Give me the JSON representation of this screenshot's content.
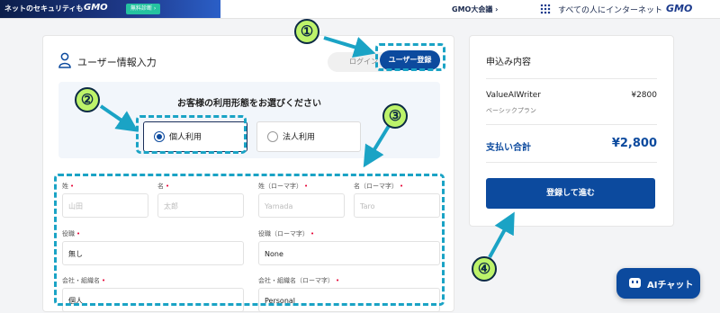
{
  "topbar": {
    "promo_text": "ネットのセキュリティも",
    "promo_logo": "GMO",
    "promo_badge": "無料診断 ›",
    "gmo_link": "GMO大会議 ›",
    "tagline": "すべての人にインターネット",
    "logo": "GMO"
  },
  "form": {
    "section_title": "ユーザー情報入力",
    "login_label": "ログイン",
    "register_label": "ユーザー登録",
    "choice_title": "お客様の利用形態をお選びください",
    "options": [
      {
        "label": "個人利用",
        "selected": true
      },
      {
        "label": "法人利用",
        "selected": false
      }
    ],
    "fields": {
      "last_name": {
        "label": "姓",
        "placeholder": "山田",
        "value": ""
      },
      "first_name": {
        "label": "名",
        "placeholder": "太郎",
        "value": ""
      },
      "last_name_roman": {
        "label": "姓（ローマ字）",
        "placeholder": "Yamada",
        "value": ""
      },
      "first_name_roman": {
        "label": "名（ローマ字）",
        "placeholder": "Taro",
        "value": ""
      },
      "position": {
        "label": "役職",
        "placeholder": "",
        "value": "無し"
      },
      "position_roman": {
        "label": "役職（ローマ字）",
        "placeholder": "",
        "value": "None"
      },
      "company": {
        "label": "会社・組織名",
        "placeholder": "",
        "value": "個人"
      },
      "company_roman": {
        "label": "会社・組織名（ローマ字）",
        "placeholder": "",
        "value": "Personal"
      }
    },
    "required_mark": "•"
  },
  "summary": {
    "title": "申込み内容",
    "product": "ValueAIWriter",
    "price": "¥2800",
    "plan": "ベーシックプラン",
    "total_label": "支払い合計",
    "total_price": "¥2,800",
    "submit_label": "登録して進む"
  },
  "callouts": [
    "①",
    "②",
    "③",
    "④"
  ],
  "chat": {
    "label": "AIチャット"
  },
  "colors": {
    "primary": "#0c4a9e",
    "annotation": "#1aa3c5",
    "callout_fill": "#bdf36a",
    "required": "#e60033"
  },
  "icons": [
    "user-icon",
    "radio-icon",
    "chat-bot-icon",
    "grid-icon"
  ]
}
